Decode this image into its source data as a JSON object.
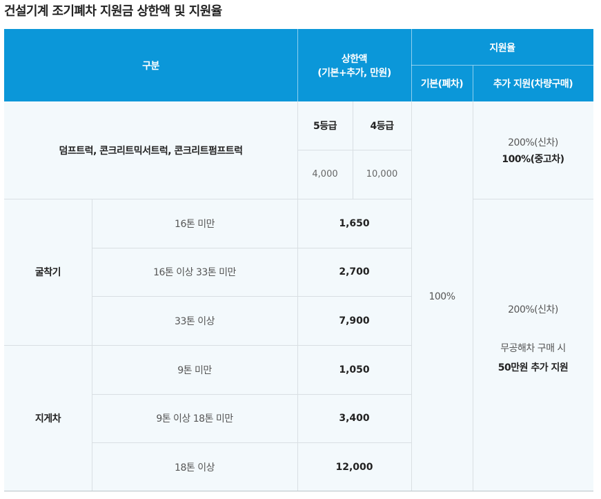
{
  "title": "건설기계 조기폐차 지원금 상한액 및 지원율",
  "header": {
    "category": "구분",
    "limit": "상한액\n(기본+추가, 만원)",
    "limit_line1": "상한액",
    "limit_line2": "(기본+추가, 만원)",
    "rate": "지원율",
    "base_rate": "기본(폐차)",
    "extra_rate": "추가 지원(차량구매)"
  },
  "dump": {
    "label": "덤프트럭, 콘크리트믹서트럭, 콘크리트펌프트럭",
    "grade5": "5등급",
    "grade4": "4등급",
    "grade5_value": "4,000",
    "grade4_value": "10,000",
    "extra_line1": "200%(신차)",
    "extra_line2": "100%(중고차)"
  },
  "excavator": {
    "label": "굴착기",
    "rows": [
      {
        "size": "16톤 미만",
        "limit": "1,650"
      },
      {
        "size": "16톤 이상 33톤 미만",
        "limit": "2,700"
      },
      {
        "size": "33톤 이상",
        "limit": "7,900"
      }
    ]
  },
  "forklift": {
    "label": "지게차",
    "rows": [
      {
        "size": "9톤 미만",
        "limit": "1,050"
      },
      {
        "size": "9톤 이상 18톤 미만",
        "limit": "3,400"
      },
      {
        "size": "18톤 이상",
        "limit": "12,000"
      }
    ]
  },
  "base_rate_value": "100%",
  "other_extra": {
    "line1": "200%(신차)",
    "line2": "무공해차 구매 시",
    "line3": "50만원 추가 지원"
  },
  "colors": {
    "header_bg": "#0b97d9",
    "body_bg": "#f3f9fc",
    "grid_line": "#d9dfe3"
  }
}
